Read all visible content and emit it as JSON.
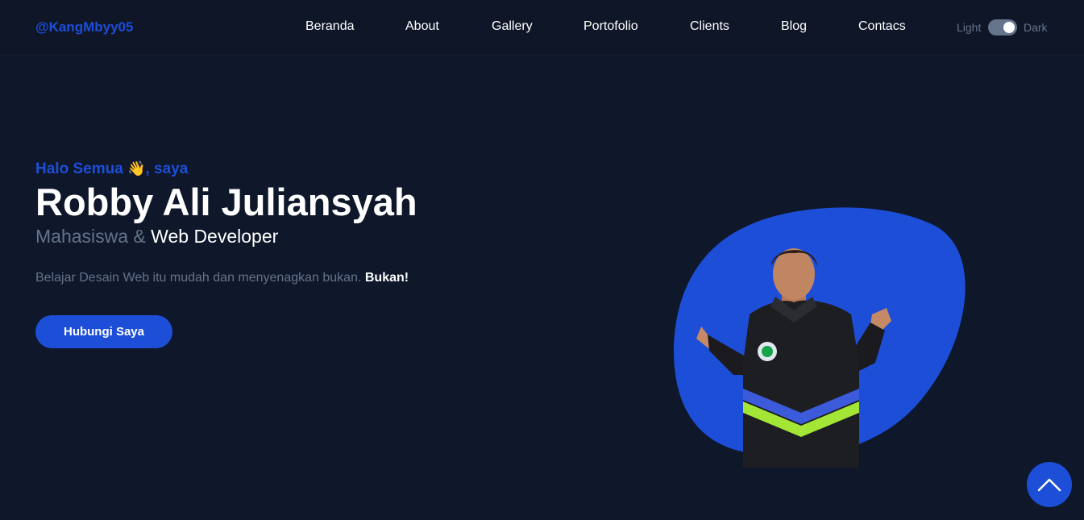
{
  "brand": "@KangMbyy05",
  "nav": {
    "items": [
      "Beranda",
      "About",
      "Gallery",
      "Portofolio",
      "Clients",
      "Blog",
      "Contacs"
    ]
  },
  "theme_toggle": {
    "light_label": "Light",
    "dark_label": "Dark",
    "selected": "Dark"
  },
  "hero": {
    "greeting_text": "Halo Semua",
    "greeting_emoji": "👋",
    "greeting_suffix": ", saya",
    "name": "Robby Ali Juliansyah",
    "role_prefix": "Mahasiswa &",
    "role_highlight": "Web Developer",
    "tagline": "Belajar Desain Web itu mudah dan menyenagkan bukan.",
    "tagline_emphasis": "Bukan!",
    "cta_label": "Hubungi Saya"
  },
  "icons": {
    "to_top": "chevron-up-icon",
    "wave": "waving-hand-icon"
  },
  "colors": {
    "background": "#0f172a",
    "navbar": "#0f1628",
    "primary": "#1d4ed8",
    "muted": "#64748b",
    "text": "#ffffff"
  }
}
